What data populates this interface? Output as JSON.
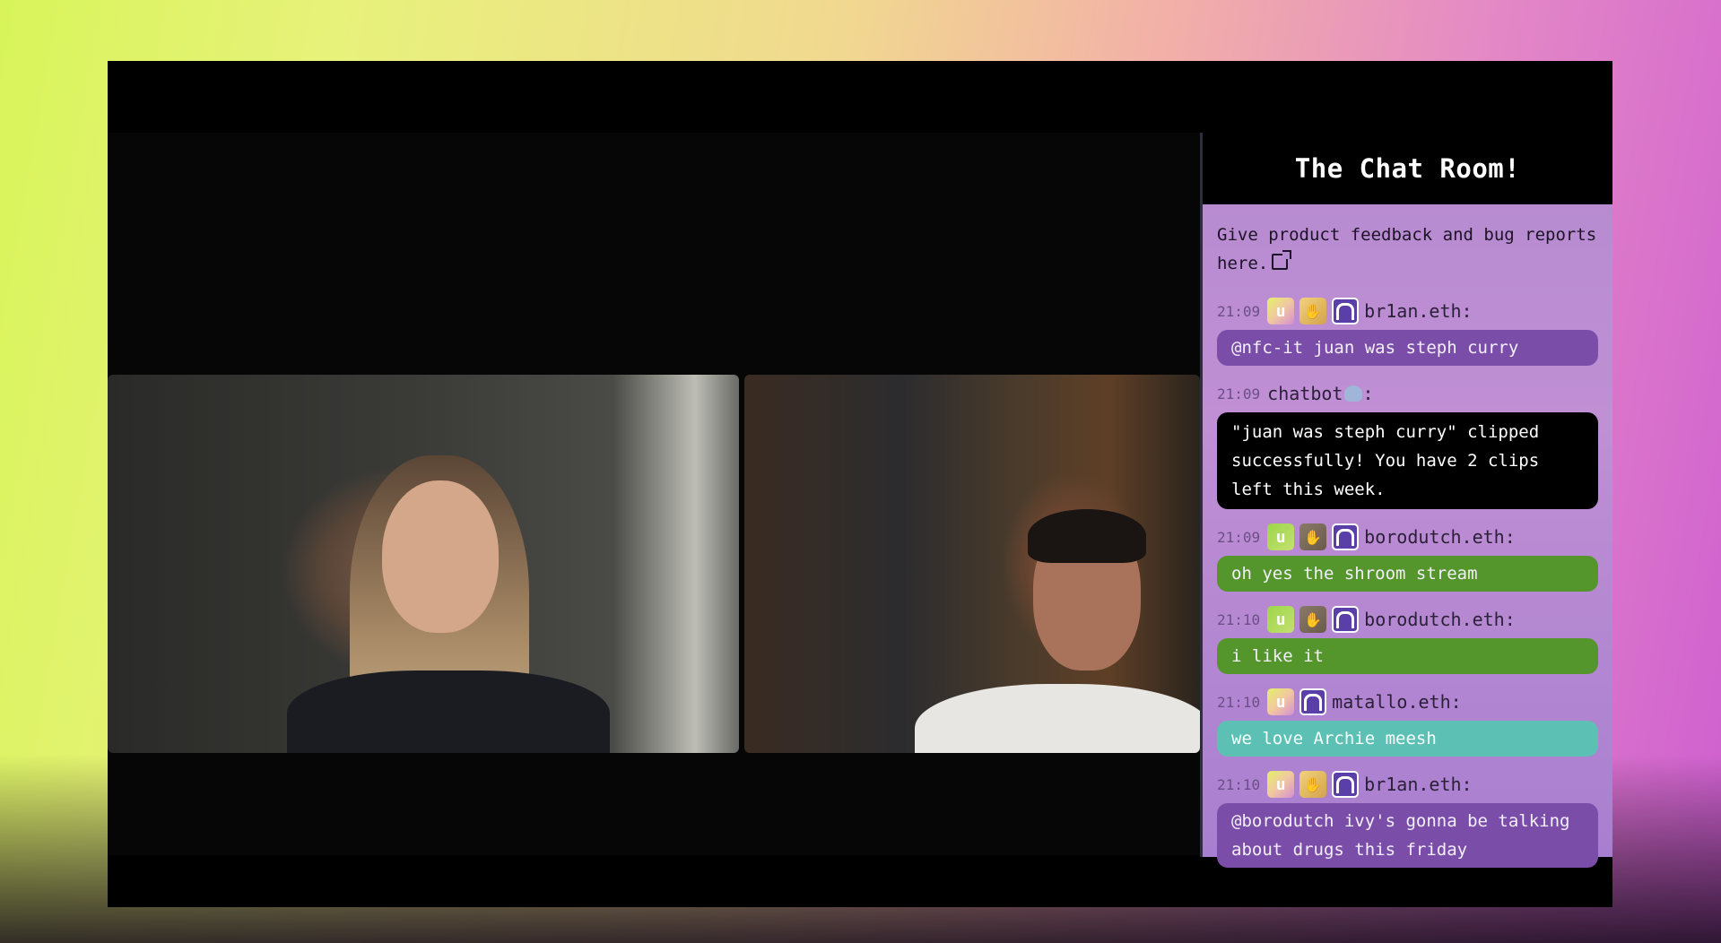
{
  "chat": {
    "title": "The Chat Room!",
    "intro": "Give product feedback and bug reports here.",
    "messages": [
      {
        "time": "21:09",
        "user": "br1an.eth:",
        "text": "@nfc-it juan was steph curry"
      },
      {
        "time": "21:09",
        "user": "chatbot",
        "suffix": ":",
        "text": "\"juan was steph curry\" clipped successfully! You have 2 clips left this week."
      },
      {
        "time": "21:09",
        "user": "borodutch.eth:",
        "text": "oh yes the shroom stream"
      },
      {
        "time": "21:10",
        "user": "borodutch.eth:",
        "text": "i like it"
      },
      {
        "time": "21:10",
        "user": "matallo.eth:",
        "text": "we love Archie meesh"
      },
      {
        "time": "21:10",
        "user": "br1an.eth:",
        "text": "@borodutch ivy's gonna be talking about drugs this friday"
      }
    ]
  },
  "badges": {
    "u": "u",
    "hand": "✋"
  },
  "colors": {
    "chat_panel": "#b58ad0",
    "bubble_purple": "#7a4ea8",
    "bubble_green": "#54952c",
    "bubble_teal": "#5cc0b4",
    "bubble_black": "#000000"
  }
}
